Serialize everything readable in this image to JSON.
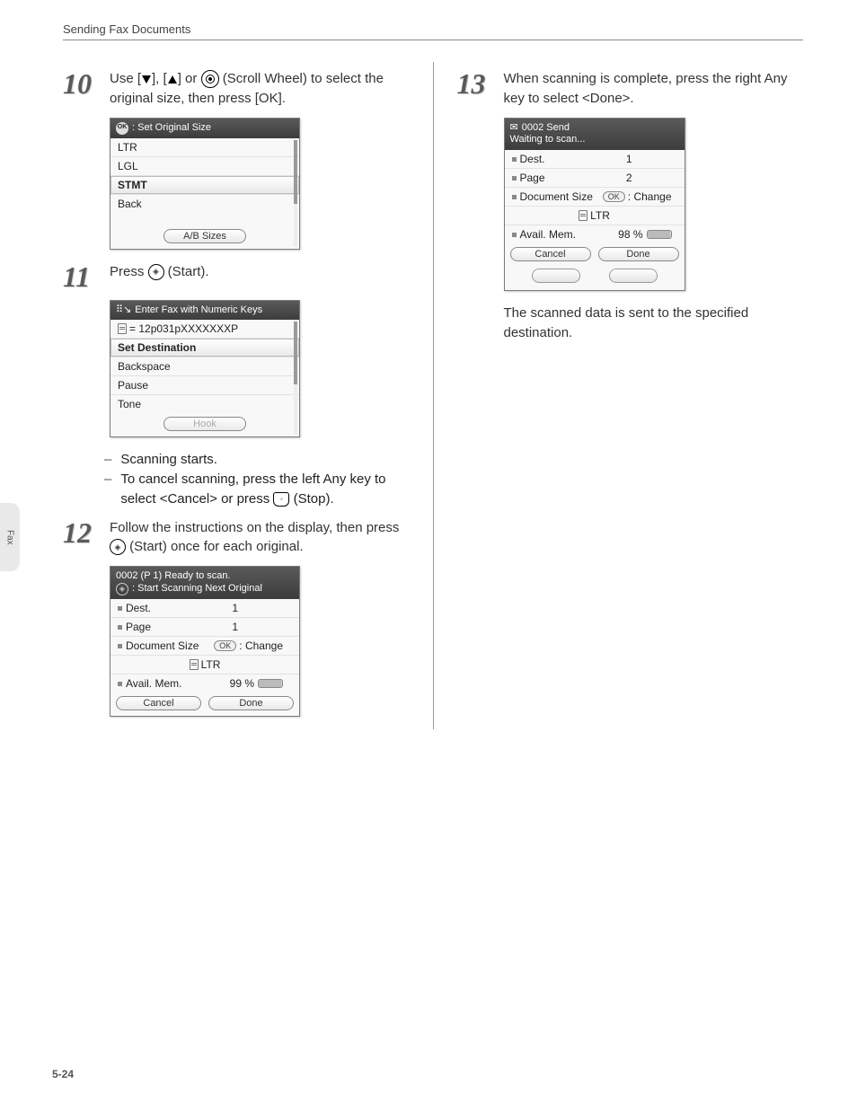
{
  "header": "Sending Fax Documents",
  "page_num": "5-24",
  "side_tab": "Fax",
  "steps": {
    "s10": {
      "num": "10",
      "text_a": "Use [",
      "text_b": "], [",
      "text_c": "] or ",
      "text_d": " (Scroll Wheel) to select the original size, then press [OK]."
    },
    "s11": {
      "num": "11",
      "text_a": "Press ",
      "text_b": " (Start)."
    },
    "s11_notes": {
      "a": "Scanning starts.",
      "b_a": "To cancel scanning, press the left Any key to select <Cancel> or press ",
      "b_b": " (Stop)."
    },
    "s12": {
      "num": "12",
      "text_a": "Follow the instructions on the display, then press ",
      "text_b": " (Start) once for each original."
    },
    "s13": {
      "num": "13",
      "text": "When scanning is complete, press the right Any key to select <Done>."
    },
    "s13_follow": "The scanned data is sent to the specified destination."
  },
  "lcd1": {
    "title": ": Set Original Size",
    "items": [
      "LTR",
      "LGL",
      "STMT",
      "Back"
    ],
    "soft": "A/B Sizes"
  },
  "lcd2": {
    "title": "Enter Fax with Numeric Keys",
    "value": "= 12p031pXXXXXXXP",
    "items": [
      "Set Destination",
      "Backspace",
      "Pause",
      "Tone"
    ],
    "soft": "Hook"
  },
  "lcd3": {
    "title_a": "0002 (P  1)  Ready to scan.",
    "title_b": ": Start Scanning Next Original",
    "rows": {
      "dest_l": "Dest.",
      "dest_v": "1",
      "page_l": "Page",
      "page_v": "1",
      "doc_l": "Document Size",
      "doc_v": ": Change",
      "ltr": "LTR",
      "mem_l": "Avail. Mem.",
      "mem_v": "99 %"
    },
    "soft_l": "Cancel",
    "soft_r": "Done"
  },
  "lcd4": {
    "title_a": "0002 Send",
    "title_b": "Waiting to scan...",
    "rows": {
      "dest_l": "Dest.",
      "dest_v": "1",
      "page_l": "Page",
      "page_v": "2",
      "doc_l": "Document Size",
      "doc_v": ": Change",
      "ltr": "LTR",
      "mem_l": "Avail. Mem.",
      "mem_v": "98 %"
    },
    "soft_l": "Cancel",
    "soft_r": "Done"
  }
}
